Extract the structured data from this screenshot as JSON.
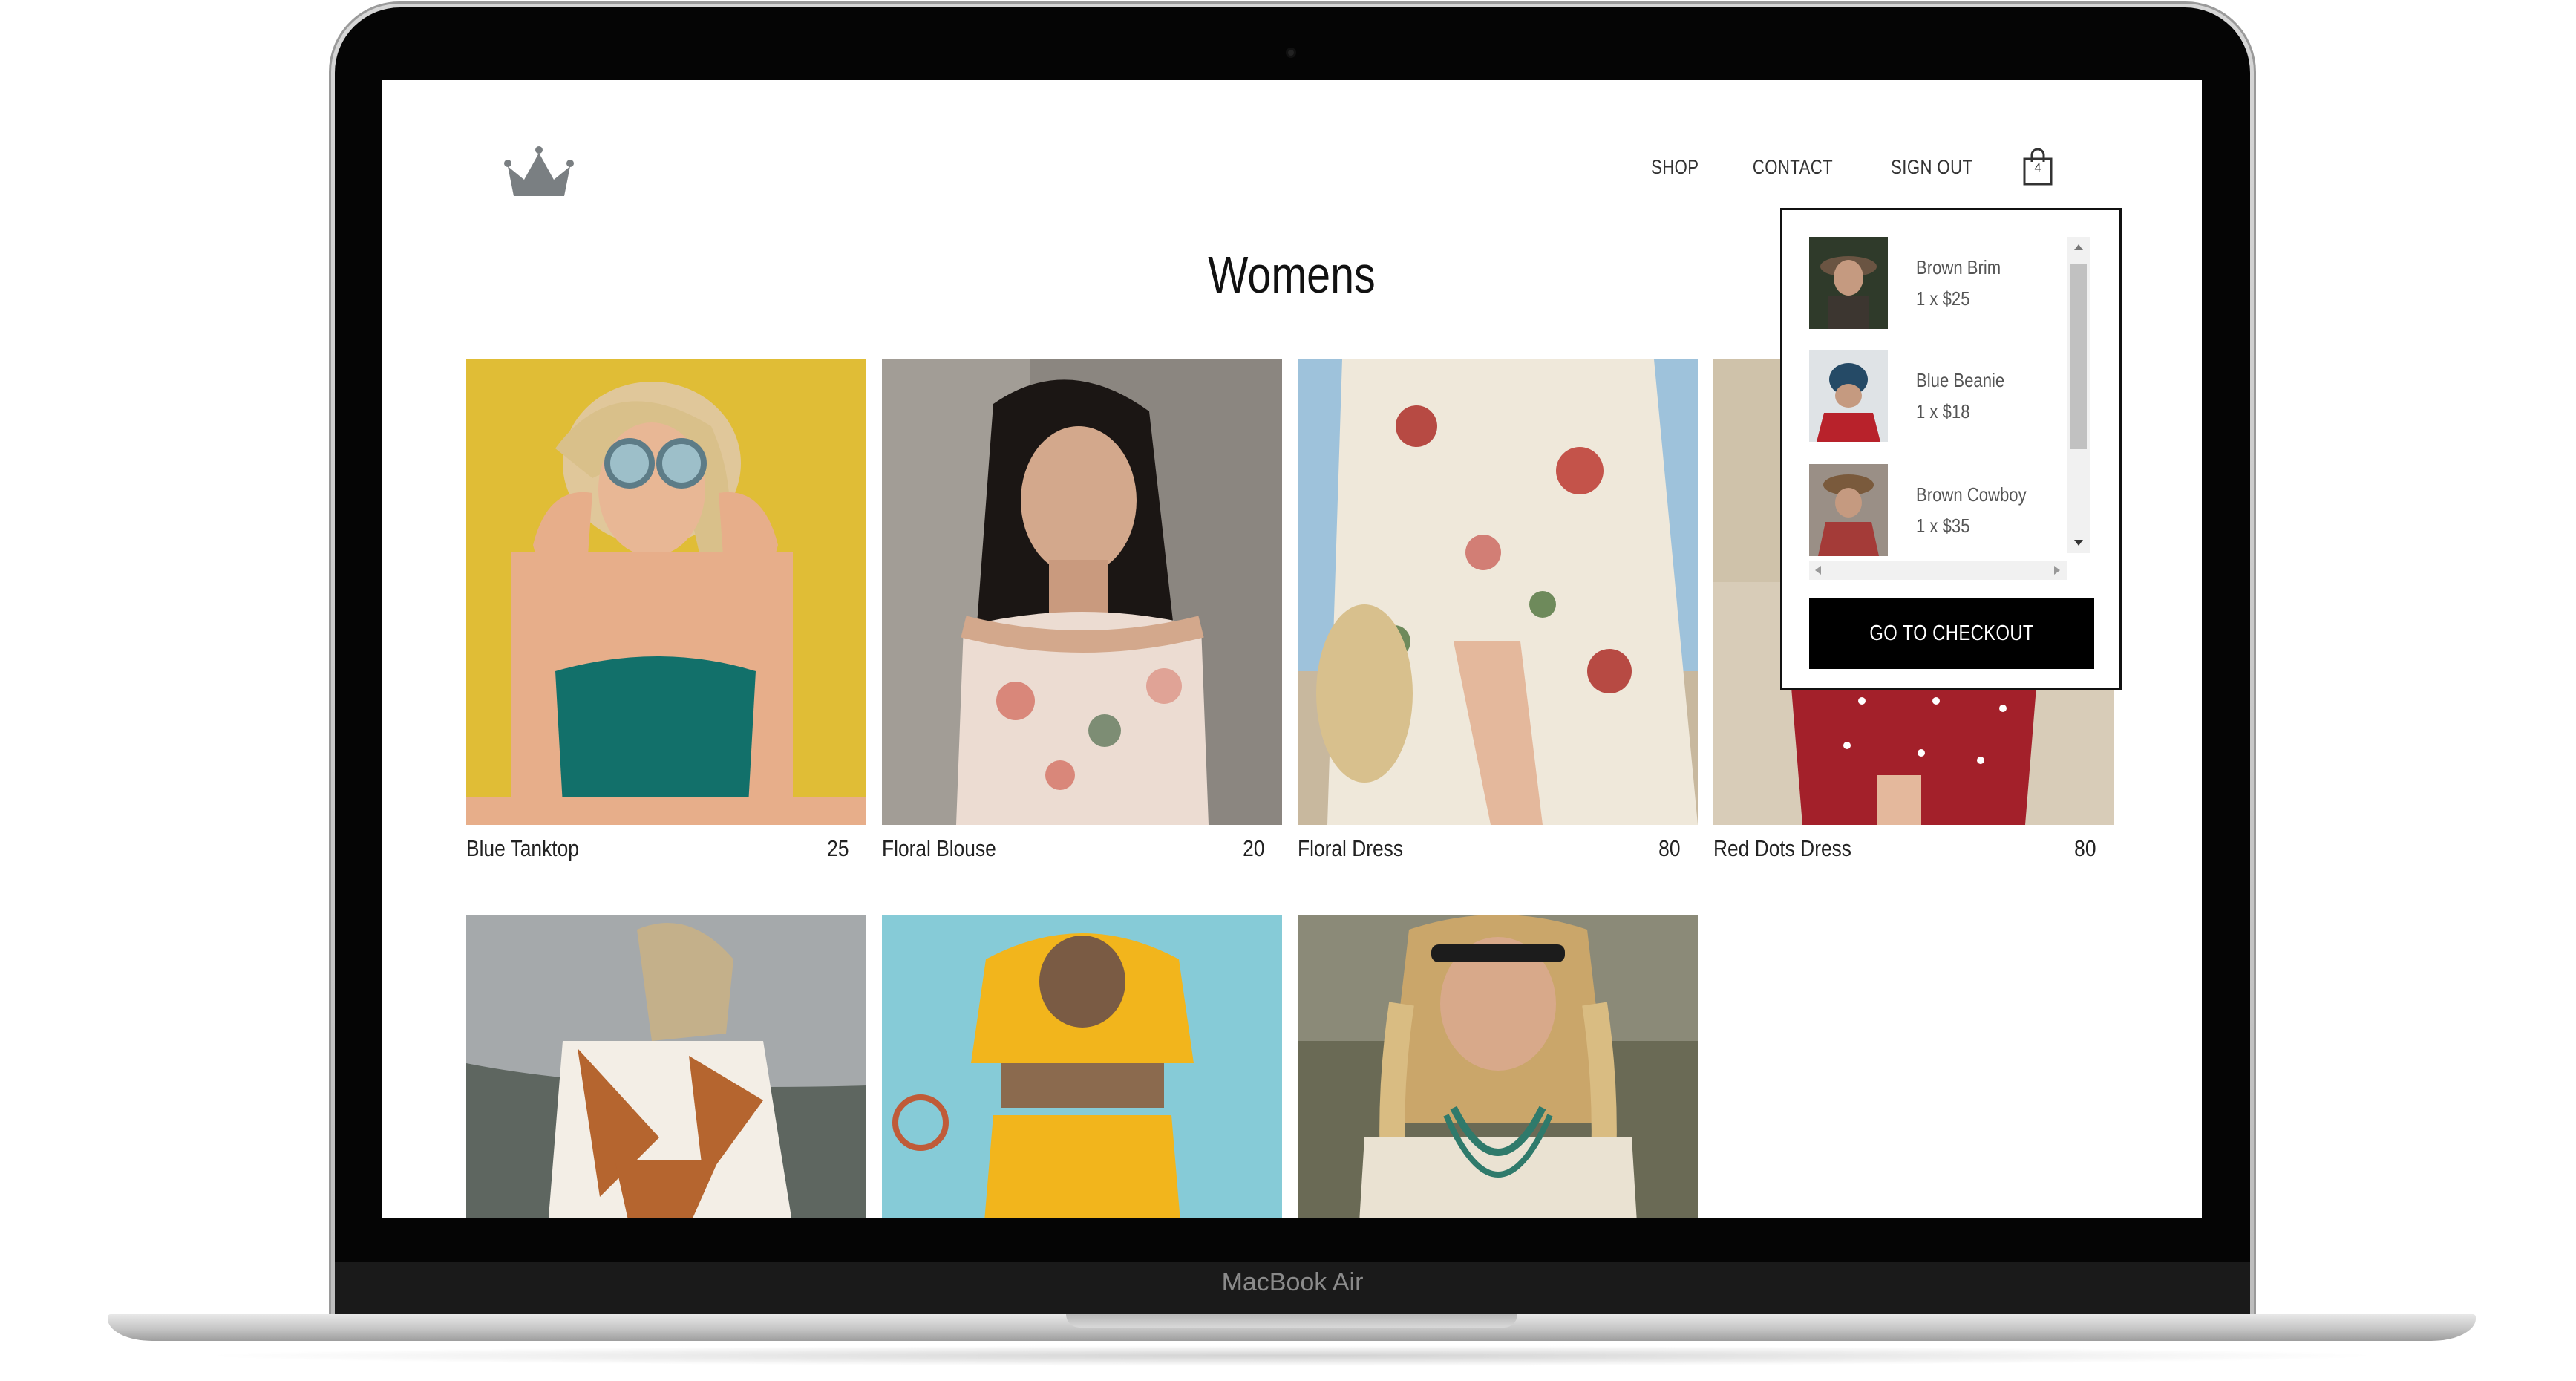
{
  "device": {
    "label": "MacBook Air"
  },
  "header": {
    "logo": "crown-icon",
    "nav": [
      {
        "label": "SHOP"
      },
      {
        "label": "CONTACT"
      },
      {
        "label": "SIGN OUT"
      }
    ],
    "cart_count": "4"
  },
  "page": {
    "title": "Womens"
  },
  "products": [
    {
      "name": "Blue Tanktop",
      "price": "25"
    },
    {
      "name": "Floral Blouse",
      "price": "20"
    },
    {
      "name": "Floral Dress",
      "price": "80"
    },
    {
      "name": "Red Dots Dress",
      "price": "80"
    },
    {
      "name": "",
      "price": ""
    },
    {
      "name": "",
      "price": ""
    },
    {
      "name": "",
      "price": ""
    }
  ],
  "cart": {
    "items": [
      {
        "name": "Brown Brim",
        "qty_price": "1 x $25"
      },
      {
        "name": "Blue Beanie",
        "qty_price": "1 x $18"
      },
      {
        "name": "Brown Cowboy",
        "qty_price": "1 x $35"
      }
    ],
    "checkout_label": "GO TO CHECKOUT"
  },
  "colors": {
    "checkout_bg": "#000000",
    "text": "#222222"
  }
}
